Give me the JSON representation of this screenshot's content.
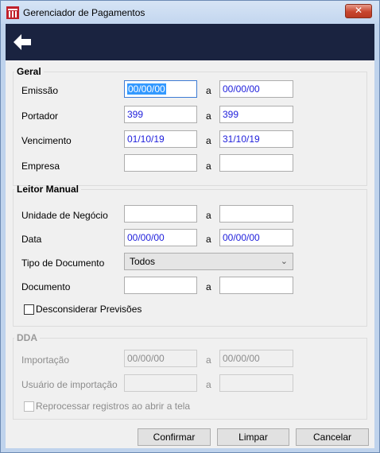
{
  "window": {
    "title": "Gerenciador de Pagamentos",
    "close_label": "✕",
    "accent": "#1a2340"
  },
  "toolbar": {
    "back_icon": "arrow-left-icon"
  },
  "geral": {
    "legend": "Geral",
    "sep": "a",
    "emissao": {
      "label": "Emissão",
      "from": "00/00/00",
      "to": "00/00/00"
    },
    "portador": {
      "label": "Portador",
      "from": "399",
      "to": "399"
    },
    "vencimento": {
      "label": "Vencimento",
      "from": "01/10/19",
      "to": "31/10/19"
    },
    "empresa": {
      "label": "Empresa",
      "from": "",
      "to": ""
    }
  },
  "leitor": {
    "legend": "Leitor Manual",
    "sep": "a",
    "unidade": {
      "label": "Unidade de Negócio",
      "from": "",
      "to": ""
    },
    "data": {
      "label": "Data",
      "from": "00/00/00",
      "to": "00/00/00"
    },
    "tipo": {
      "label": "Tipo de Documento",
      "value": "Todos"
    },
    "documento": {
      "label": "Documento",
      "from": "",
      "to": ""
    },
    "desconsiderar": {
      "label": "Desconsiderar Previsões",
      "checked": false
    }
  },
  "dda": {
    "legend": "DDA",
    "sep": "a",
    "importacao": {
      "label": "Importação",
      "from": "00/00/00",
      "to": "00/00/00"
    },
    "usuario": {
      "label": "Usuário de importação",
      "from": "",
      "to": ""
    },
    "reprocessar": {
      "label": "Reprocessar registros ao abrir a tela",
      "checked": false
    }
  },
  "buttons": {
    "confirmar": "Confirmar",
    "limpar": "Limpar",
    "cancelar": "Cancelar"
  }
}
